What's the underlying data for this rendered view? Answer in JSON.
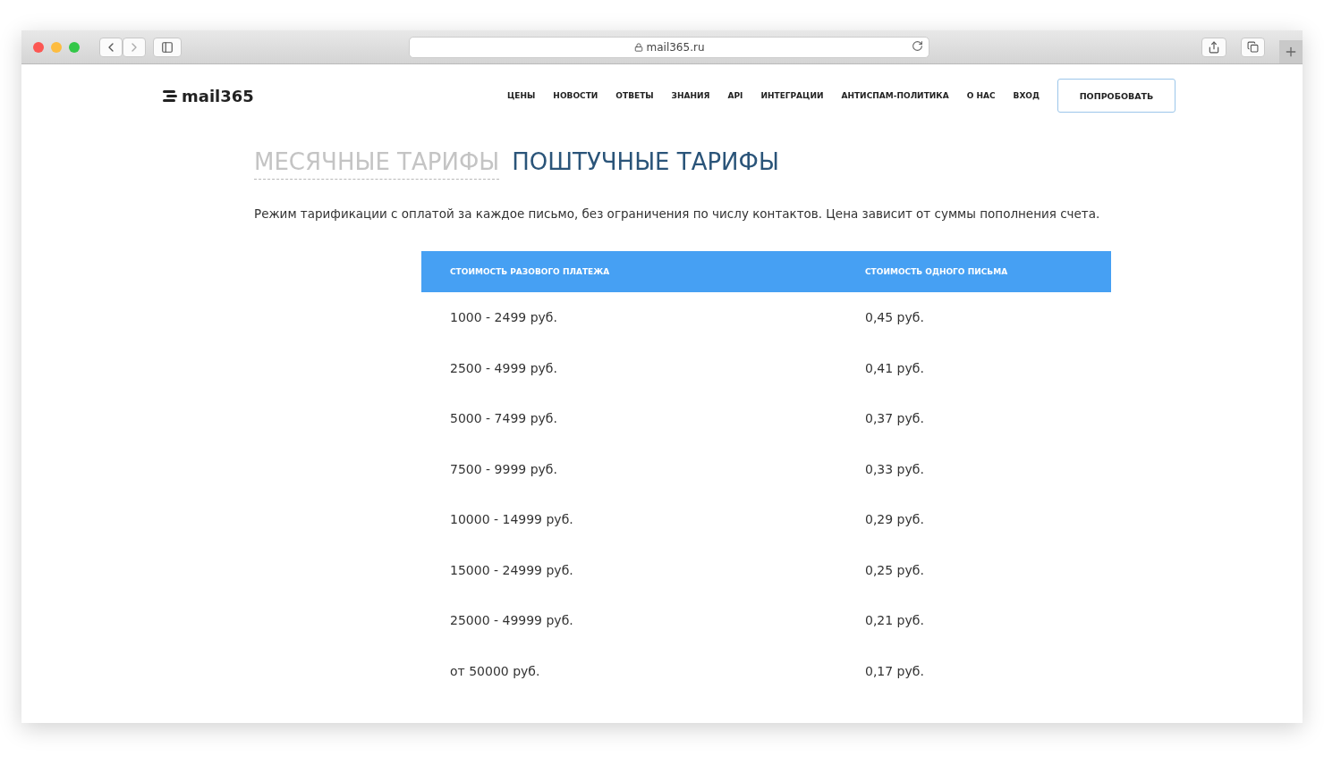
{
  "browser": {
    "address": "mail365.ru"
  },
  "header": {
    "logo": "mail365",
    "nav": [
      "ЦЕНЫ",
      "НОВОСТИ",
      "ОТВЕТЫ",
      "ЗНАНИЯ",
      "API",
      "ИНТЕГРАЦИИ",
      "АНТИСПАМ-ПОЛИТИКА",
      "О НАС",
      "ВХОД"
    ],
    "cta": "ПОПРОБОВАТЬ"
  },
  "tabs": [
    {
      "label": "МЕСЯЧНЫЕ ТАРИФЫ",
      "selected": false
    },
    {
      "label": "ПОШТУЧНЫЕ ТАРИФЫ",
      "selected": true
    }
  ],
  "description": "Режим тарификации с оплатой за каждое письмо, без ограничения по числу контактов. Цена зависит от суммы пополнения счета.",
  "table": {
    "columns": [
      "СТОИМОСТЬ РАЗОВОГО ПЛАТЕЖА",
      "СТОИМОСТЬ ОДНОГО ПИСЬМА"
    ],
    "rows": [
      [
        "1000 - 2499 руб.",
        "0,45 руб."
      ],
      [
        "2500 - 4999 руб.",
        "0,41 руб."
      ],
      [
        "5000 - 7499 руб.",
        "0,37 руб."
      ],
      [
        "7500 - 9999 руб.",
        "0,33 руб."
      ],
      [
        "10000 - 14999 руб.",
        "0,29 руб."
      ],
      [
        "15000 - 24999 руб.",
        "0,25 руб."
      ],
      [
        "25000 - 49999 руб.",
        "0,21 руб."
      ],
      [
        "от 50000 руб.",
        "0,17 руб."
      ]
    ]
  }
}
